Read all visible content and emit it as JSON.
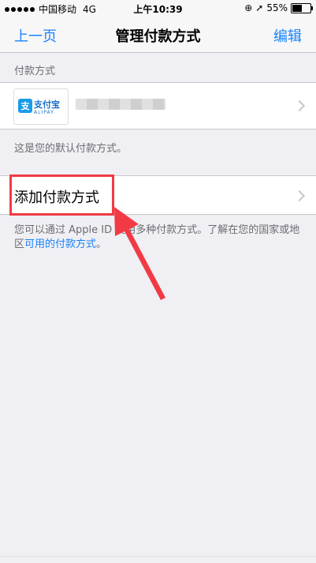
{
  "status_bar": {
    "carrier": "中国移动",
    "network": "4G",
    "time": "上午10:39",
    "battery": "55%",
    "battery_level": 0.55,
    "icons": [
      "signal-dots",
      "rotation-lock-icon",
      "location-arrow-icon",
      "battery-icon"
    ]
  },
  "nav": {
    "back_label": "上一页",
    "title": "管理付款方式",
    "edit_label": "编辑"
  },
  "payment_section": {
    "header": "付款方式",
    "method": {
      "brand_cn": "支付宝",
      "brand_en": "ALIPAY"
    },
    "footer": "这是您的默认付款方式。"
  },
  "add_payment": {
    "label": "添加付款方式"
  },
  "info": {
    "text": "您可以通过 Apple ID 使用多种付款方式。了解在您的国家或地区",
    "link": "可用的付款方式",
    "suffix": "。"
  },
  "colors": {
    "accent": "#1a82fb",
    "highlight": "#f23a44",
    "background": "#efeff4"
  }
}
